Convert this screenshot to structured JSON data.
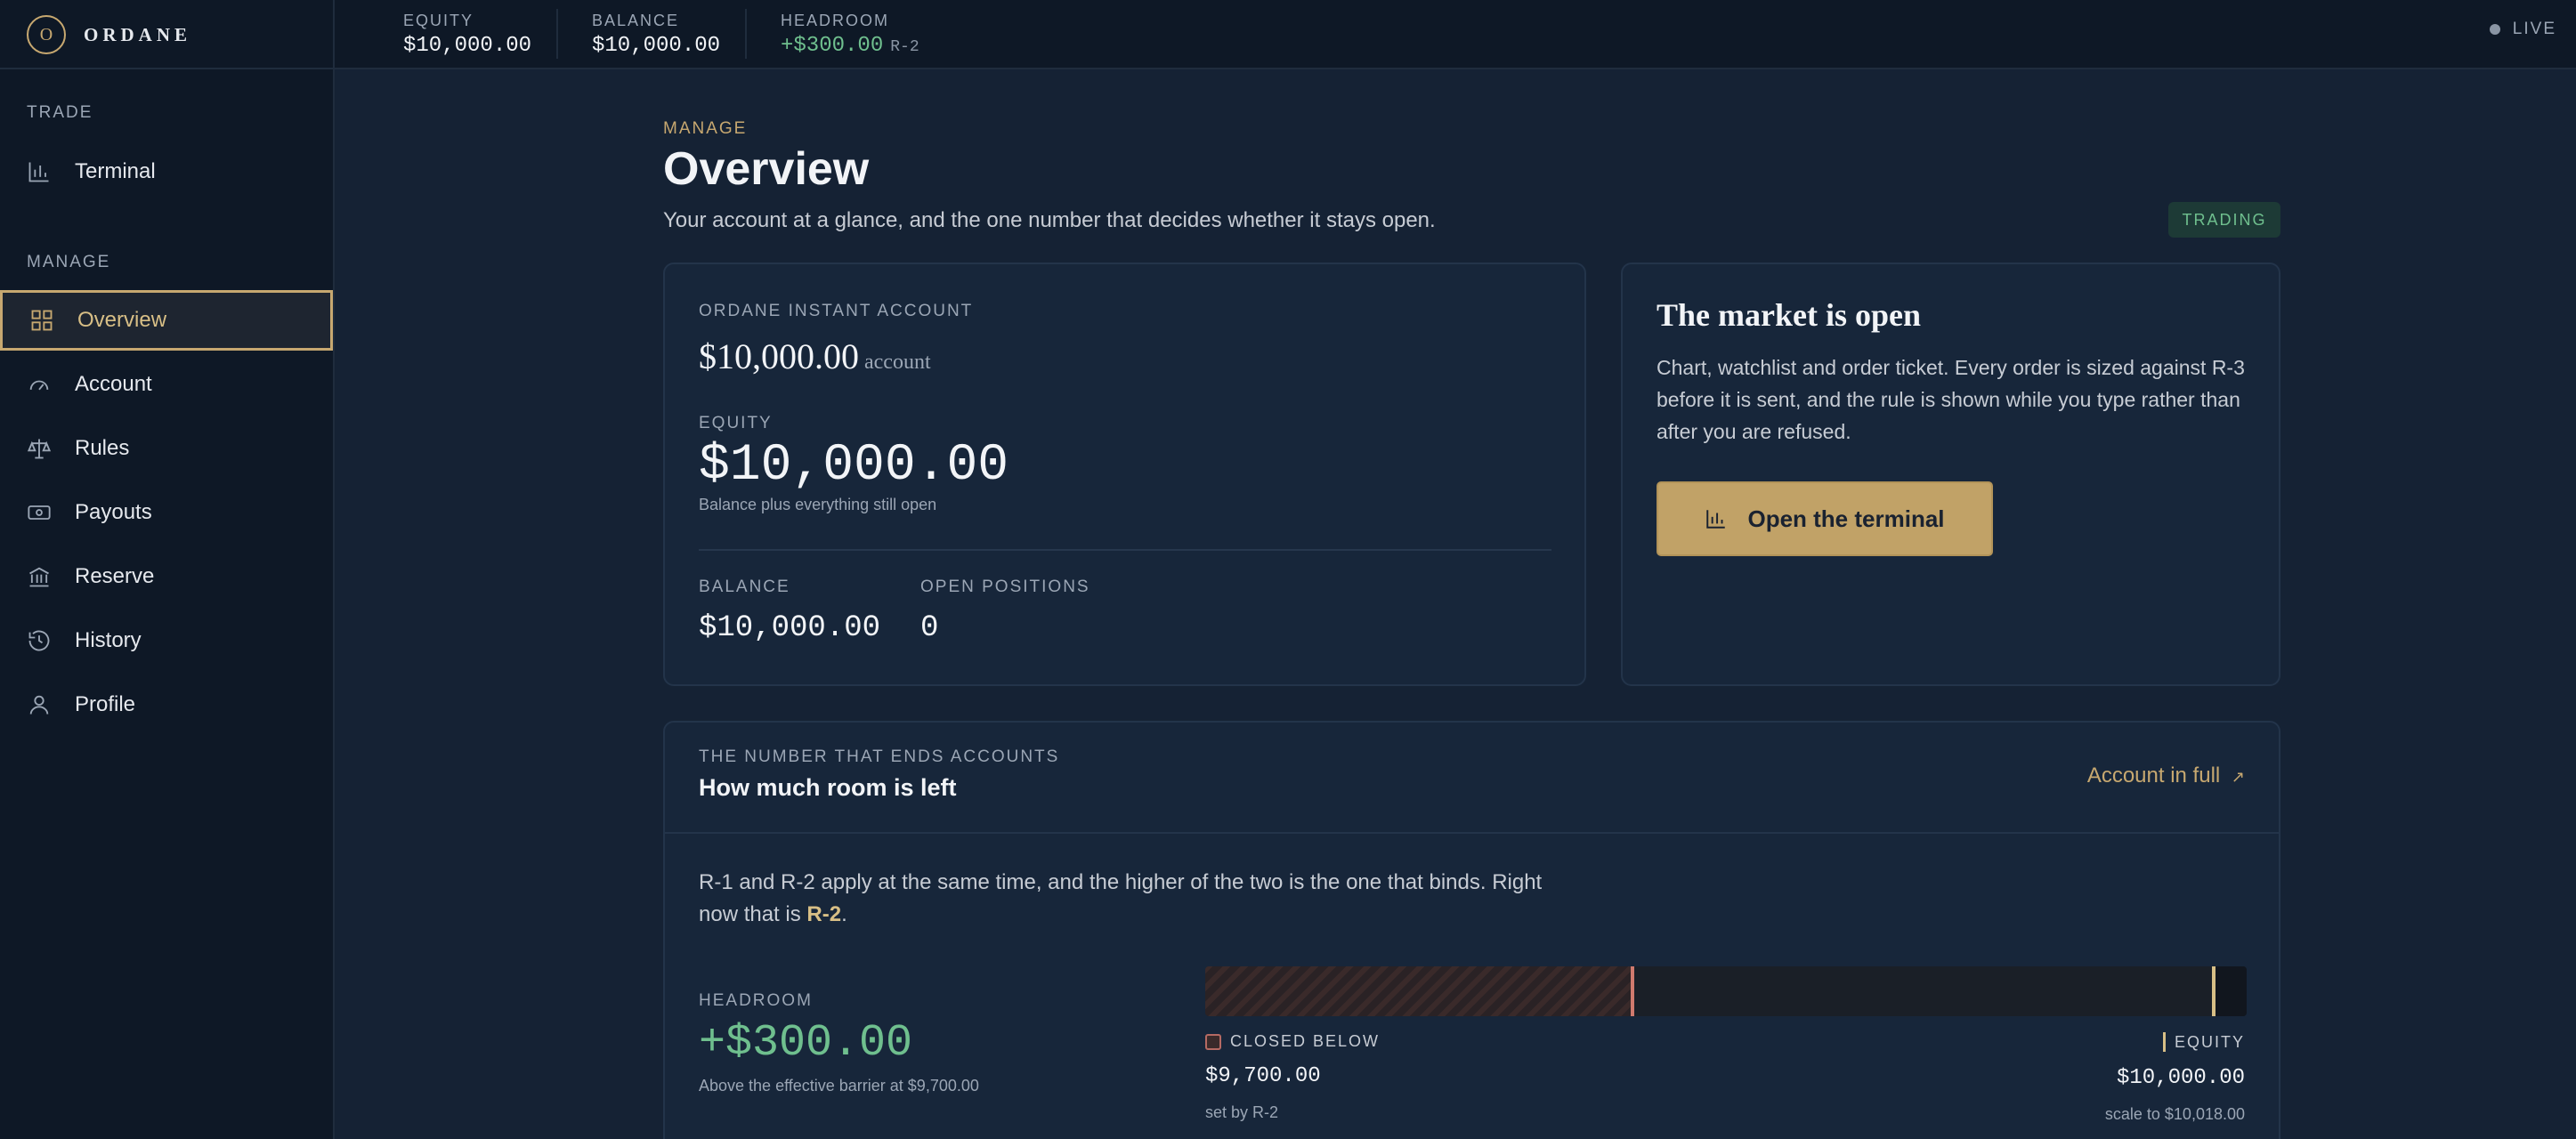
{
  "brand": {
    "mark": "O",
    "name": "ORDANE"
  },
  "topbar": {
    "equity_label": "EQUITY",
    "equity_value": "$10,000.00",
    "balance_label": "BALANCE",
    "balance_value": "$10,000.00",
    "headroom_label": "HEADROOM",
    "headroom_value": "+$300.00",
    "headroom_rule": "R-2",
    "live_label": "LIVE"
  },
  "sidebar": {
    "trade_section": "TRADE",
    "manage_section": "MANAGE",
    "items": [
      {
        "label": "Terminal",
        "icon": "chart-icon"
      },
      {
        "label": "Overview",
        "icon": "grid-icon",
        "active": true
      },
      {
        "label": "Account",
        "icon": "gauge-icon"
      },
      {
        "label": "Rules",
        "icon": "scale-icon"
      },
      {
        "label": "Payouts",
        "icon": "banknote-icon"
      },
      {
        "label": "Reserve",
        "icon": "bank-icon"
      },
      {
        "label": "History",
        "icon": "history-icon"
      },
      {
        "label": "Profile",
        "icon": "user-icon"
      }
    ]
  },
  "page": {
    "eyebrow": "MANAGE",
    "title": "Overview",
    "subtitle": "Your account at a glance, and the one number that decides whether it stays open.",
    "status_badge": "TRADING"
  },
  "account_card": {
    "label": "ORDANE INSTANT ACCOUNT",
    "amount": "$10,000.00",
    "amount_unit": "account",
    "equity_label": "EQUITY",
    "equity_value": "$10,000.00",
    "equity_note": "Balance plus everything still open",
    "balance_label": "BALANCE",
    "balance_value": "$10,000.00",
    "positions_label": "OPEN POSITIONS",
    "positions_value": "0"
  },
  "market_card": {
    "title": "The market is open",
    "text": "Chart, watchlist and order ticket. Every order is sized against R-3 before it is sent, and the rule is shown while you type rather than after you are refused.",
    "cta_label": "Open the terminal"
  },
  "room_card": {
    "eyebrow": "THE NUMBER THAT ENDS ACCOUNTS",
    "title": "How much room is left",
    "link_label": "Account in full",
    "link_arrow": "↗",
    "text_before": "R-1 and R-2 apply at the same time, and the higher of the two is the one that binds. Right now that is ",
    "binding_rule": "R-2",
    "text_after": ".",
    "headroom_label": "HEADROOM",
    "headroom_value": "+$300.00",
    "headroom_note": "Above the effective barrier at $9,700.00",
    "closed_label": "CLOSED BELOW",
    "closed_value": "$9,700.00",
    "closed_sub": "set by R-2",
    "equity_label": "EQUITY",
    "equity_value": "$10,000.00",
    "scale_sub": "scale to $10,018.00",
    "bar": {
      "scale_min": 9480,
      "scale_max": 10018,
      "barrier": 9700,
      "equity": 10000
    },
    "colors": {
      "barrier": "#d07a6e",
      "equity": "#d8bf86"
    }
  }
}
